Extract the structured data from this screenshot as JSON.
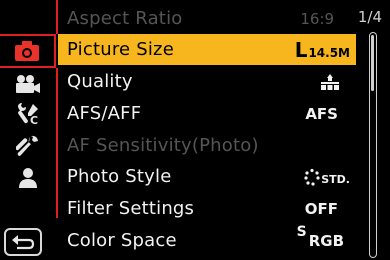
{
  "page_indicator": "1/4",
  "sidebar": {
    "tabs": [
      {
        "name": "photo",
        "icon": "camera-icon",
        "active": true
      },
      {
        "name": "video",
        "icon": "video-camera-icon",
        "active": false
      },
      {
        "name": "custom",
        "icon": "custom-tools-icon",
        "active": false
      },
      {
        "name": "setup",
        "icon": "wrench-icon",
        "active": false
      },
      {
        "name": "my-menu",
        "icon": "person-icon",
        "active": false
      }
    ],
    "back_icon": "return-arrow-icon"
  },
  "menu": {
    "items": [
      {
        "label": "Aspect Ratio",
        "value": "16:9",
        "state": "dimmed"
      },
      {
        "label": "Picture Size",
        "value_main": "L",
        "value_sub": "14.5M",
        "state": "selected"
      },
      {
        "label": "Quality",
        "value_icon": "fine-quality-icon",
        "state": "normal"
      },
      {
        "label": "AFS/AFF",
        "value": "AFS",
        "state": "normal"
      },
      {
        "label": "AF Sensitivity(Photo)",
        "value": "",
        "state": "disabled"
      },
      {
        "label": "Photo Style",
        "value_icon": "photo-style-icon",
        "value": "STD.",
        "state": "normal"
      },
      {
        "label": "Filter Settings",
        "value": "OFF",
        "state": "normal"
      },
      {
        "label": "Color Space",
        "value_main": "S",
        "value_sub": "RGB",
        "state": "normal"
      }
    ]
  },
  "colors": {
    "accent": "#e02020",
    "highlight": "#f7b61d",
    "text": "#f2f2f2",
    "disabled": "#555555"
  }
}
